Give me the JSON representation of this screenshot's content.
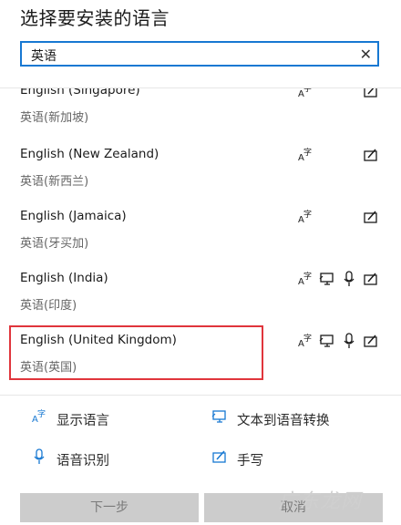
{
  "title": "选择要安装的语言",
  "search": {
    "value": "英语"
  },
  "languages": [
    {
      "name": "English (Singapore)",
      "local": "英语(新加坡)",
      "features": [
        "display-language"
      ]
    },
    {
      "name": "English (New Zealand)",
      "local": "英语(新西兰)",
      "features": [
        "display-language"
      ]
    },
    {
      "name": "English (Jamaica)",
      "local": "英语(牙买加)",
      "features": [
        "display-language"
      ]
    },
    {
      "name": "English (India)",
      "local": "英语(印度)",
      "features": [
        "display-language",
        "text-to-speech",
        "speech-recognition"
      ]
    },
    {
      "name": "English (United Kingdom)",
      "local": "英语(英国)",
      "features": [
        "display-language",
        "text-to-speech",
        "speech-recognition"
      ]
    }
  ],
  "legend": {
    "display_language": "显示语言",
    "text_to_speech": "文本到语音转换",
    "speech_recognition": "语音识别",
    "handwriting": "手写"
  },
  "buttons": {
    "next": "下一步",
    "cancel": "取消"
  },
  "watermark": "广东龙网",
  "colors": {
    "accent": "#1778d2",
    "highlight": "#e0353c",
    "icon": "#1a1a1a",
    "legend_icon": "#1778d2"
  }
}
